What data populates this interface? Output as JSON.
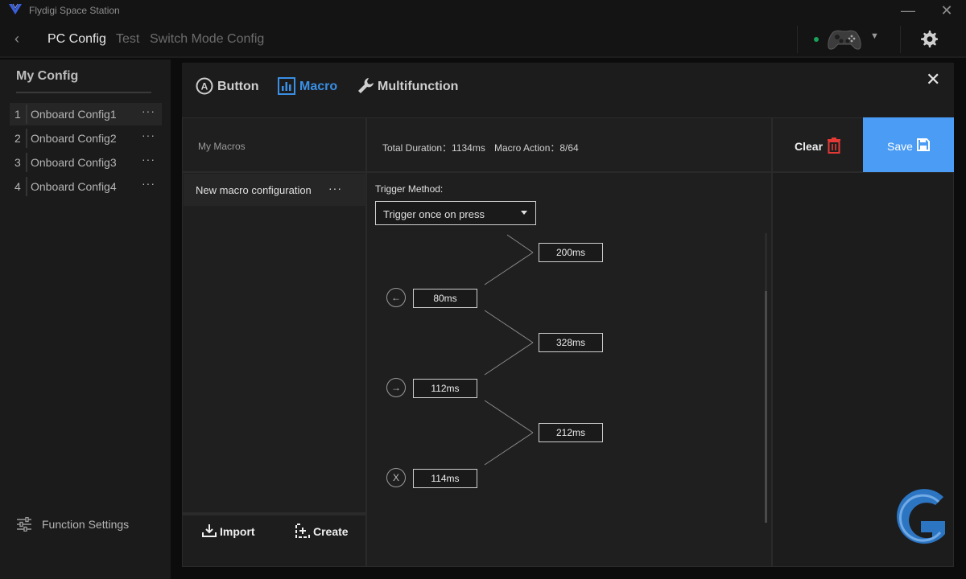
{
  "app": {
    "title": "Flydigi Space Station",
    "minimize_icon": "minimize-icon",
    "close_icon": "close-icon"
  },
  "nav": {
    "tabs": [
      {
        "label": "PC Config",
        "active": true
      },
      {
        "label": "Test",
        "active": false
      },
      {
        "label": "Switch Mode Config",
        "active": false
      }
    ],
    "device_status_color": "#19a35a"
  },
  "sidebar": {
    "heading": "My Config",
    "configs": [
      {
        "num": "1",
        "name": "Onboard Config1",
        "active": true
      },
      {
        "num": "2",
        "name": "Onboard Config2",
        "active": false
      },
      {
        "num": "3",
        "name": "Onboard Config3",
        "active": false
      },
      {
        "num": "4",
        "name": "Onboard Config4",
        "active": false
      }
    ],
    "more": "···",
    "function_settings": "Function Settings"
  },
  "modal": {
    "tabs": [
      {
        "label": "Button",
        "icon": "a-button-icon",
        "active": false
      },
      {
        "label": "Macro",
        "icon": "macro-icon",
        "active": true
      },
      {
        "label": "Multifunction",
        "icon": "wrench-icon",
        "active": false
      }
    ],
    "my_macros": "My Macros",
    "total_duration": "Total Duration：1134ms",
    "macro_action": "Macro Action：8/64",
    "clear": "Clear",
    "save": "Save",
    "macro_item": "New macro configuration",
    "macro_item_more": "···",
    "import": "Import",
    "create": "Create",
    "trigger_label": "Trigger Method:",
    "trigger_value": "Trigger once on press",
    "steps": [
      {
        "key": "←",
        "press": "80ms",
        "gap": "200ms"
      },
      {
        "key": "→",
        "press": "112ms",
        "gap": "328ms"
      },
      {
        "key": "X",
        "press": "114ms",
        "gap": "212ms"
      }
    ]
  },
  "colors": {
    "accent": "#4a9cf4",
    "active_tab": "#3a8fe6",
    "clear_icon": "#e53935"
  }
}
